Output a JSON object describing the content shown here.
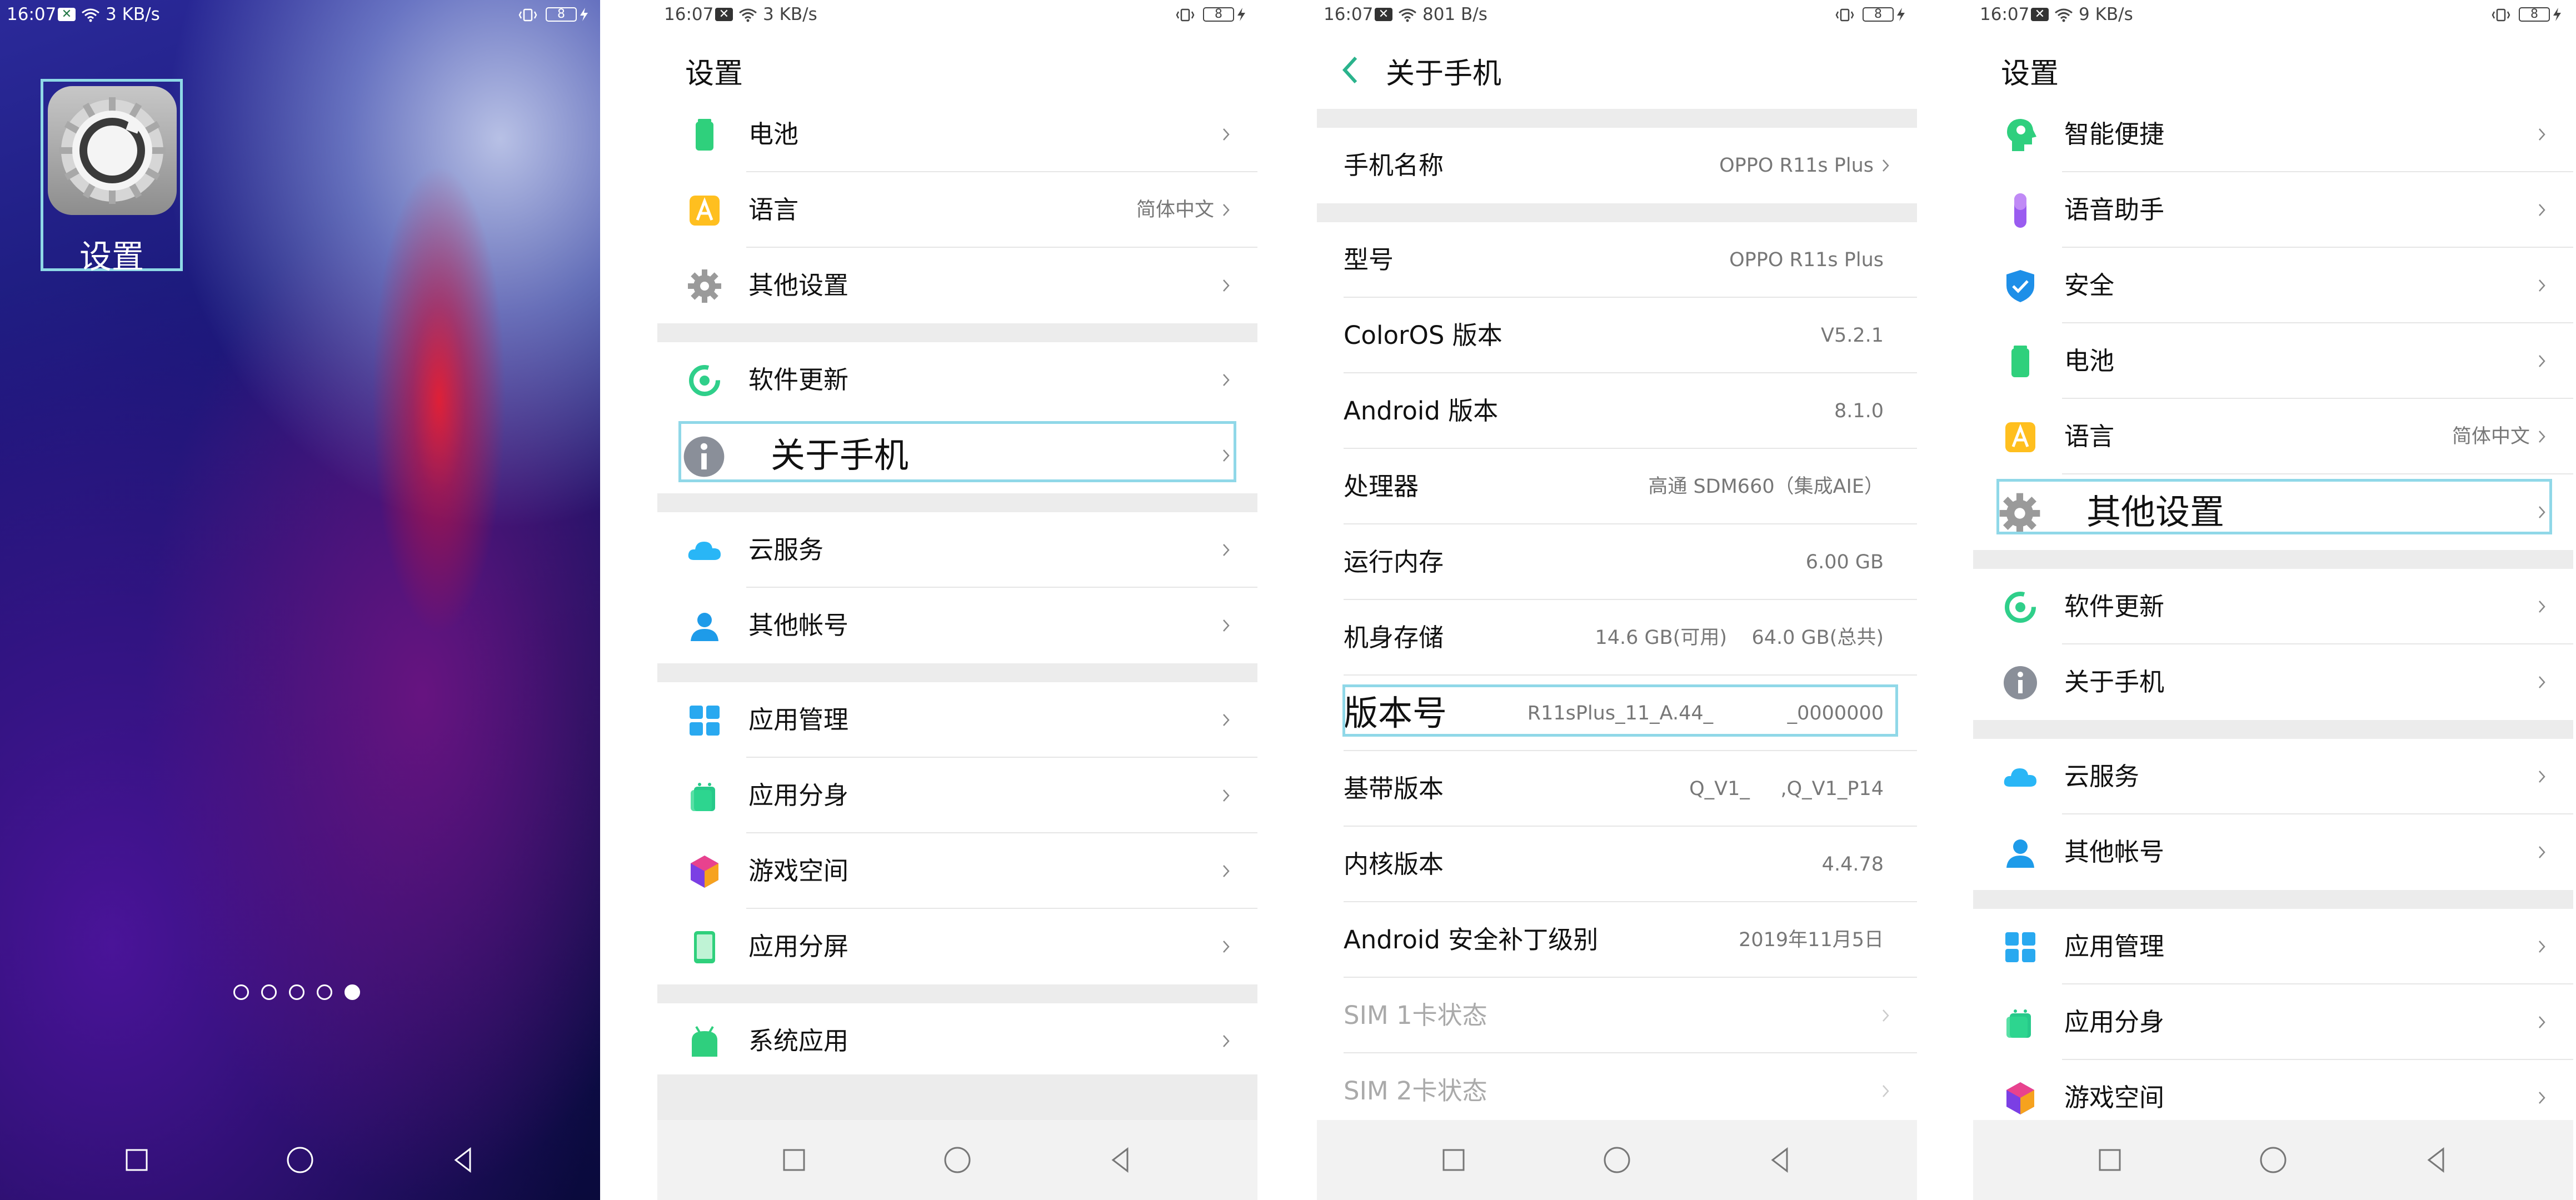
{
  "colors": {
    "accent": "#2ab38c",
    "highlight": "#90d8e8"
  },
  "home": {
    "status": {
      "time": "16:07",
      "speed": "3 KB/s",
      "battery": "8"
    },
    "app_label": "设置",
    "page_dots": 5,
    "active_dot": 5
  },
  "settings1": {
    "status": {
      "time": "16:07",
      "speed": "3 KB/s",
      "battery": "8"
    },
    "title": "设置",
    "rows": [
      {
        "label": "电池",
        "value": "",
        "icon": "battery-icon"
      },
      {
        "label": "语言",
        "value": "简体中文",
        "icon": "language-icon"
      },
      {
        "label": "其他设置",
        "value": "",
        "icon": "gear-icon"
      },
      {
        "label": "软件更新",
        "value": "",
        "icon": "update-icon"
      },
      {
        "label": "关于手机",
        "value": "",
        "icon": "info-icon"
      },
      {
        "label": "云服务",
        "value": "",
        "icon": "cloud-icon"
      },
      {
        "label": "其他帐号",
        "value": "",
        "icon": "account-icon"
      },
      {
        "label": "应用管理",
        "value": "",
        "icon": "app-manage-icon"
      },
      {
        "label": "应用分身",
        "value": "",
        "icon": "app-clone-icon"
      },
      {
        "label": "游戏空间",
        "value": "",
        "icon": "game-space-icon"
      },
      {
        "label": "应用分屏",
        "value": "",
        "icon": "split-screen-icon"
      },
      {
        "label": "系统应用",
        "value": "",
        "icon": "system-apps-icon"
      }
    ]
  },
  "about": {
    "status": {
      "time": "16:07",
      "speed": "801 B/s",
      "battery": "8"
    },
    "title": "关于手机",
    "rows": [
      {
        "label": "手机名称",
        "value": "OPPO R11s Plus"
      },
      {
        "label": "型号",
        "value": "OPPO R11s Plus"
      },
      {
        "label": "ColorOS 版本",
        "value": "V5.2.1"
      },
      {
        "label": "Android 版本",
        "value": "8.1.0"
      },
      {
        "label": "处理器",
        "value": "高通 SDM660（集成AIE）"
      },
      {
        "label": "运行内存",
        "value": "6.00 GB"
      },
      {
        "label": "机身存储",
        "value": "14.6 GB(可用)    64.0 GB(总共)"
      },
      {
        "label": "版本号",
        "value": "R11sPlus_11_A.44_            _0000000"
      },
      {
        "label": "基带版本",
        "value": "Q_V1_     ,Q_V1_P14"
      },
      {
        "label": "内核版本",
        "value": "4.4.78"
      },
      {
        "label": "Android 安全补丁级别",
        "value": "2019年11月5日"
      },
      {
        "label": "SIM 1卡状态",
        "value": ""
      },
      {
        "label": "SIM 2卡状态",
        "value": ""
      }
    ]
  },
  "settings2": {
    "status": {
      "time": "16:07",
      "speed": "9 KB/s",
      "battery": "8"
    },
    "title": "设置",
    "rows": [
      {
        "label": "智能便捷",
        "value": "",
        "icon": "smart-icon"
      },
      {
        "label": "语音助手",
        "value": "",
        "icon": "mic-icon"
      },
      {
        "label": "安全",
        "value": "",
        "icon": "shield-icon"
      },
      {
        "label": "电池",
        "value": "",
        "icon": "battery-icon"
      },
      {
        "label": "语言",
        "value": "简体中文",
        "icon": "language-icon"
      },
      {
        "label": "其他设置",
        "value": "",
        "icon": "gear-icon"
      },
      {
        "label": "软件更新",
        "value": "",
        "icon": "update-icon"
      },
      {
        "label": "关于手机",
        "value": "",
        "icon": "info-icon"
      },
      {
        "label": "云服务",
        "value": "",
        "icon": "cloud-icon"
      },
      {
        "label": "其他帐号",
        "value": "",
        "icon": "account-icon"
      },
      {
        "label": "应用管理",
        "value": "",
        "icon": "app-manage-icon"
      },
      {
        "label": "应用分身",
        "value": "",
        "icon": "app-clone-icon"
      },
      {
        "label": "游戏空间",
        "value": "",
        "icon": "game-space-icon"
      }
    ]
  }
}
